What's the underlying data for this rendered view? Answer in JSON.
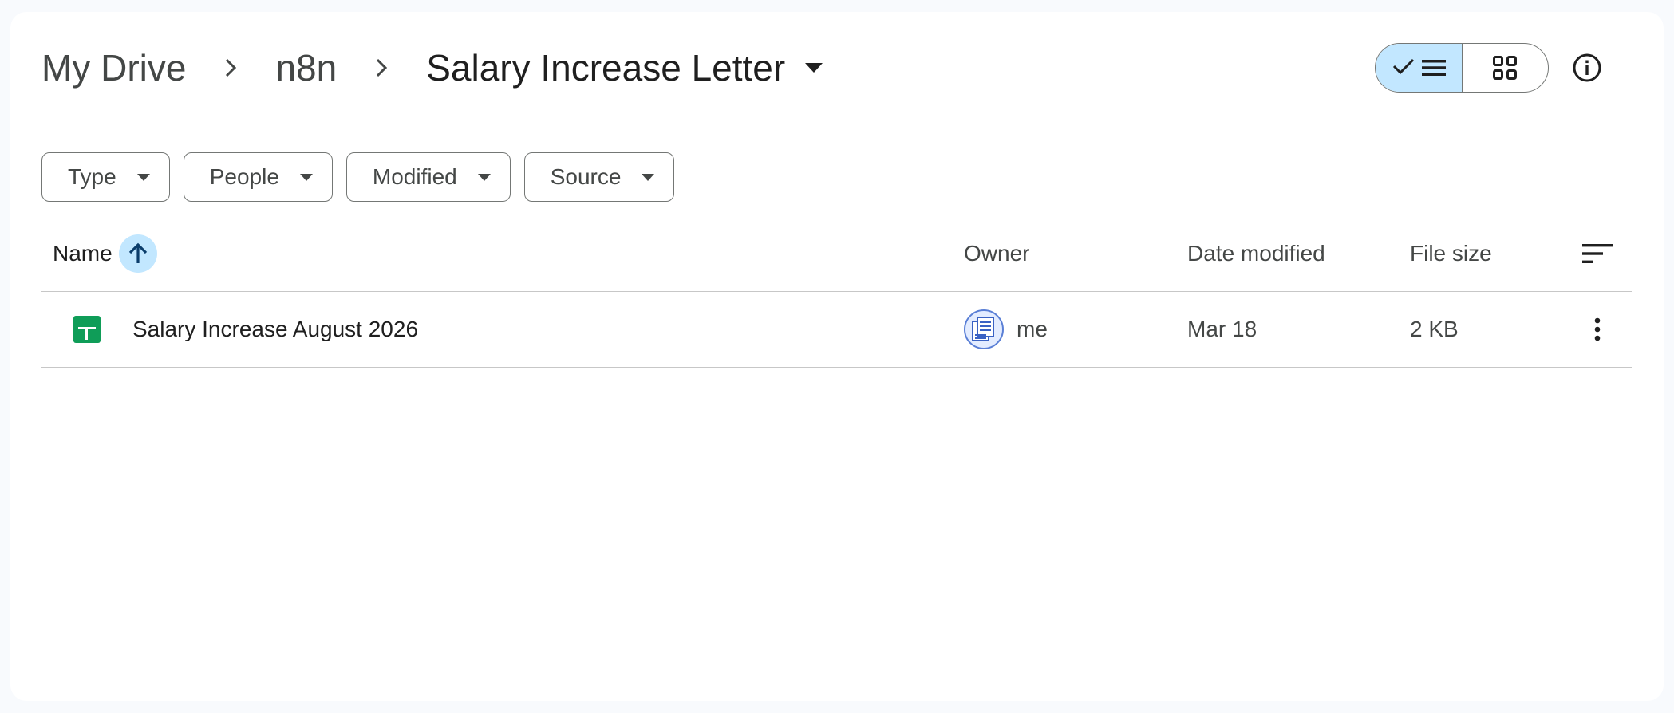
{
  "breadcrumb": {
    "root": "My Drive",
    "parent": "n8n",
    "current": "Salary Increase Letter"
  },
  "view_toggle": {
    "list_icon": "list-view-icon",
    "grid_icon": "grid-view-icon",
    "check_icon": "checkmark-icon",
    "active": "list"
  },
  "info_icon": "info-icon",
  "filters": [
    {
      "label": "Type"
    },
    {
      "label": "People"
    },
    {
      "label": "Modified"
    },
    {
      "label": "Source"
    }
  ],
  "table": {
    "headers": {
      "name": "Name",
      "owner": "Owner",
      "date_modified": "Date modified",
      "file_size": "File size"
    },
    "sort_icon": "arrow-up-icon",
    "rows": [
      {
        "icon": "google-sheets-icon",
        "name": "Salary Increase August 2026",
        "owner": "me",
        "date_modified": "Mar 18",
        "file_size": "2 KB"
      }
    ]
  },
  "colors": {
    "accent": "#c2e7ff",
    "sheets_green": "#0f9d58",
    "border": "#747775"
  }
}
